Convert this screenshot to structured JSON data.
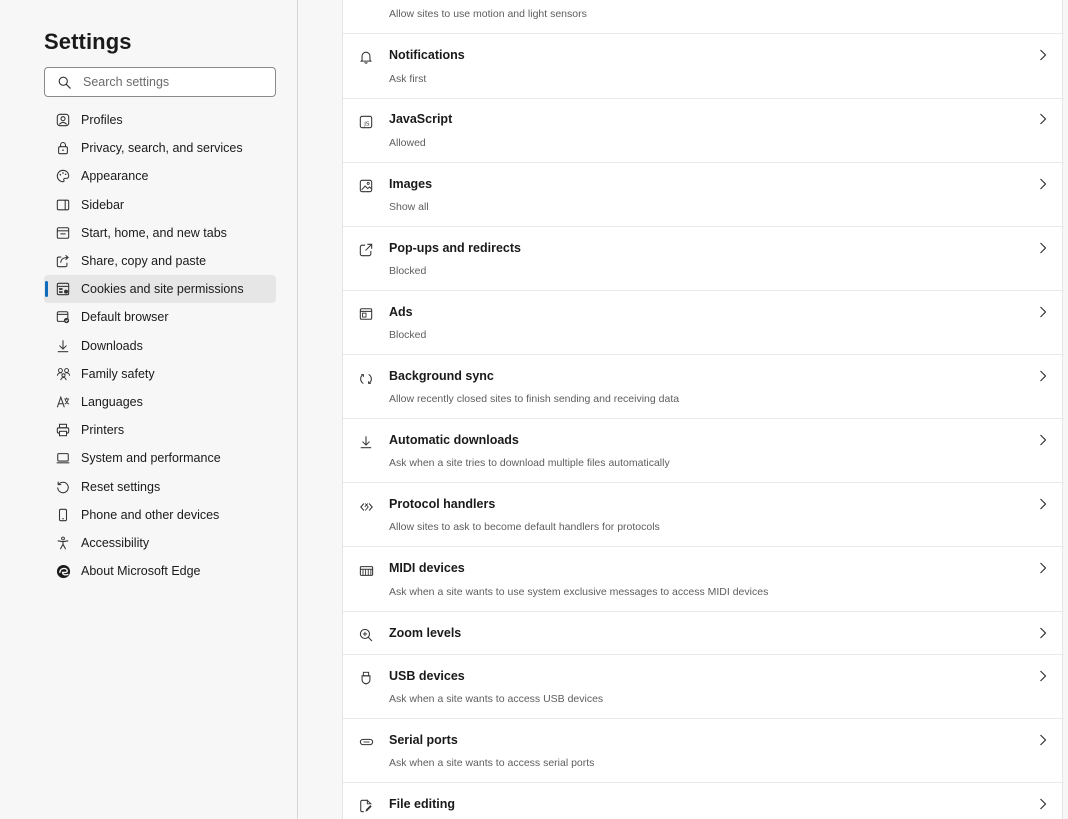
{
  "sidebar": {
    "title": "Settings",
    "search_placeholder": "Search settings",
    "items": [
      {
        "label": "Profiles",
        "icon": "profile-icon"
      },
      {
        "label": "Privacy, search, and services",
        "icon": "lock-icon"
      },
      {
        "label": "Appearance",
        "icon": "appearance-icon"
      },
      {
        "label": "Sidebar",
        "icon": "sidebar-icon"
      },
      {
        "label": "Start, home, and new tabs",
        "icon": "home-tabs-icon"
      },
      {
        "label": "Share, copy and paste",
        "icon": "share-icon"
      },
      {
        "label": "Cookies and site permissions",
        "icon": "cookies-icon",
        "active": true
      },
      {
        "label": "Default browser",
        "icon": "default-browser-icon"
      },
      {
        "label": "Downloads",
        "icon": "download-icon"
      },
      {
        "label": "Family safety",
        "icon": "family-icon"
      },
      {
        "label": "Languages",
        "icon": "language-icon"
      },
      {
        "label": "Printers",
        "icon": "printer-icon"
      },
      {
        "label": "System and performance",
        "icon": "system-icon"
      },
      {
        "label": "Reset settings",
        "icon": "reset-icon"
      },
      {
        "label": "Phone and other devices",
        "icon": "phone-icon"
      },
      {
        "label": "Accessibility",
        "icon": "accessibility-icon"
      },
      {
        "label": "About Microsoft Edge",
        "icon": "edge-logo-icon"
      }
    ]
  },
  "main": {
    "top_partial_desc": "Allow sites to use motion and light sensors",
    "rows": [
      {
        "title": "Notifications",
        "desc": "Ask first",
        "icon": "bell-icon"
      },
      {
        "title": "JavaScript",
        "desc": "Allowed",
        "icon": "javascript-icon"
      },
      {
        "title": "Images",
        "desc": "Show all",
        "icon": "image-icon"
      },
      {
        "title": "Pop-ups and redirects",
        "desc": "Blocked",
        "icon": "popup-icon"
      },
      {
        "title": "Ads",
        "desc": "Blocked",
        "icon": "ads-icon"
      },
      {
        "title": "Background sync",
        "desc": "Allow recently closed sites to finish sending and receiving data",
        "icon": "sync-icon"
      },
      {
        "title": "Automatic downloads",
        "desc": "Ask when a site tries to download multiple files automatically",
        "icon": "download-icon"
      },
      {
        "title": "Protocol handlers",
        "desc": "Allow sites to ask to become default handlers for protocols",
        "icon": "protocol-icon"
      },
      {
        "title": "MIDI devices",
        "desc": "Ask when a site wants to use system exclusive messages to access MIDI devices",
        "icon": "midi-icon"
      },
      {
        "title": "Zoom levels",
        "desc": "",
        "icon": "zoom-icon"
      },
      {
        "title": "USB devices",
        "desc": "Ask when a site wants to access USB devices",
        "icon": "usb-icon"
      },
      {
        "title": "Serial ports",
        "desc": "Ask when a site wants to access serial ports",
        "icon": "serial-port-icon"
      },
      {
        "title": "File editing",
        "desc": "",
        "icon": "file-edit-icon"
      }
    ]
  },
  "colors": {
    "accent": "#0f6cbd",
    "active_bg": "#e6e6e6",
    "text": "#1a1a1a",
    "secondary_text": "#5e5e5e"
  }
}
